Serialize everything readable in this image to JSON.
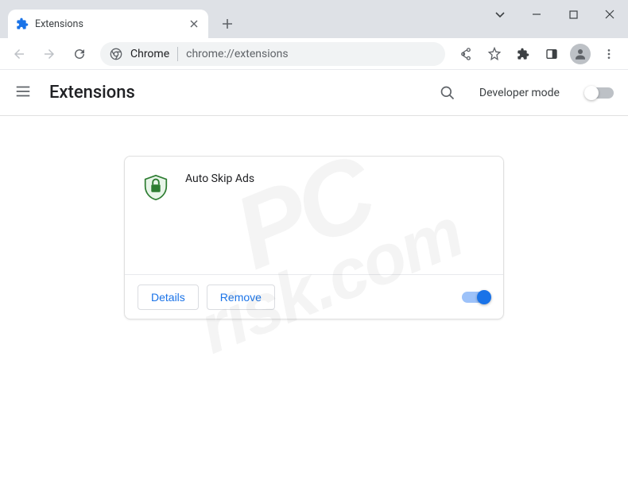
{
  "tab": {
    "title": "Extensions"
  },
  "omnibox": {
    "prefix": "Chrome",
    "url": "chrome://extensions"
  },
  "header": {
    "title": "Extensions",
    "dev_mode_label": "Developer mode"
  },
  "extension": {
    "name": "Auto Skip Ads",
    "details_label": "Details",
    "remove_label": "Remove",
    "enabled": true
  },
  "watermark": {
    "line1": "PC",
    "line2": "risk.com"
  }
}
